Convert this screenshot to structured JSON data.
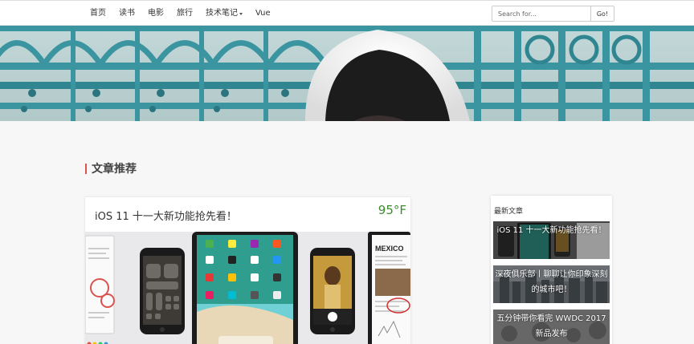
{
  "nav": {
    "items": [
      {
        "label": "首页"
      },
      {
        "label": "读书"
      },
      {
        "label": "电影"
      },
      {
        "label": "旅行"
      },
      {
        "label": "技术笔记"
      },
      {
        "label": "Vue"
      }
    ],
    "search_placeholder": "Search for...",
    "search_button": "Go!"
  },
  "section": {
    "title": "文章推荐"
  },
  "article": {
    "title": "iOS 11 十一大新功能抢先看！",
    "weather": "95°F",
    "screen_text": "MEXICO"
  },
  "sidebar": {
    "title": "最新文章",
    "items": [
      {
        "label": "iOS 11 十一大新功能抢先看！"
      },
      {
        "label": "深夜俱乐部丨聊聊让你印象深刻的城市吧！"
      },
      {
        "label": "五分钟带你看完 WWDC 2017 新品发布"
      }
    ]
  },
  "colors": {
    "accent_bar": "#d9534f",
    "weather_text": "#3c8c2e",
    "banner_teal": "#3a95a0"
  }
}
